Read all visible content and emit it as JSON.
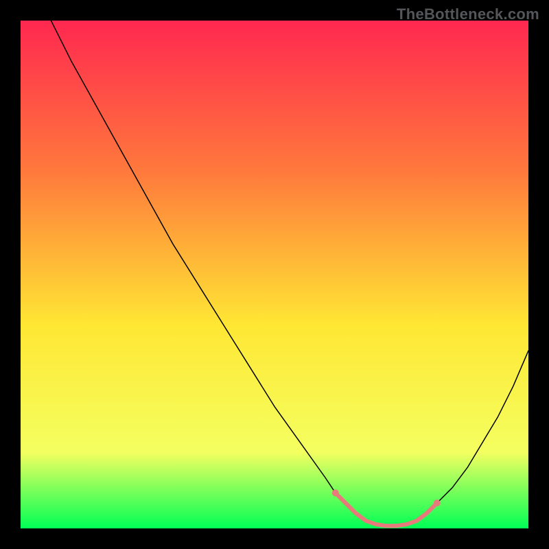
{
  "watermark": "TheBottleneck.com",
  "chart_data": {
    "type": "line",
    "title": "",
    "xlabel": "",
    "ylabel": "",
    "xlim": [
      0,
      100
    ],
    "ylim": [
      0,
      100
    ],
    "grid": false,
    "legend": false,
    "background_gradient": {
      "top": "#ff2850",
      "mid_upper": "#ff7a3c",
      "mid": "#ffe734",
      "mid_lower": "#f4ff60",
      "bottom": "#00ff55"
    },
    "series": [
      {
        "name": "curve",
        "color": "#000000",
        "width": 1.5,
        "x": [
          6,
          10,
          15,
          20,
          25,
          30,
          35,
          40,
          45,
          50,
          55,
          60,
          62,
          64,
          66,
          68,
          70,
          72,
          74,
          76,
          78,
          80,
          82,
          85,
          88,
          91,
          94,
          97,
          100
        ],
        "y": [
          100,
          92,
          83,
          74,
          65,
          56,
          48,
          40,
          32,
          24,
          17,
          10,
          7,
          5,
          3,
          1.5,
          0.8,
          0.5,
          0.5,
          0.8,
          1.5,
          3,
          5,
          8,
          12,
          17,
          22,
          28,
          35
        ]
      },
      {
        "name": "highlight-segment",
        "color": "#e77b7b",
        "width": 6,
        "x": [
          62,
          64,
          66,
          68,
          70,
          72,
          74,
          76,
          78,
          80,
          82
        ],
        "y": [
          7,
          5,
          3,
          1.5,
          0.8,
          0.5,
          0.5,
          0.8,
          1.5,
          3,
          5
        ]
      }
    ],
    "markers": [
      {
        "name": "highlight-start-marker",
        "x": 62,
        "y": 7,
        "r": 5,
        "color": "#e77b7b"
      },
      {
        "name": "highlight-end-marker",
        "x": 82,
        "y": 5,
        "r": 5,
        "color": "#e77b7b"
      }
    ]
  }
}
